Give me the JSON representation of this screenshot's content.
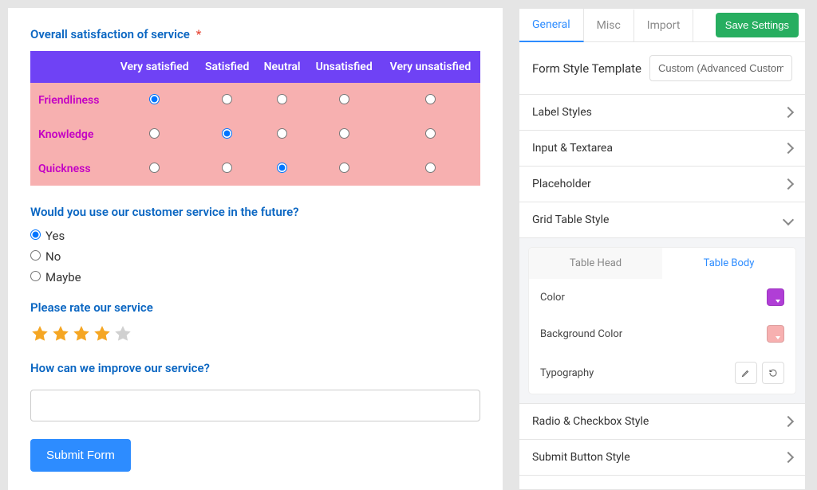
{
  "form": {
    "q1": {
      "label": "Overall satisfaction of service",
      "required": true,
      "columns": [
        "Very satisfied",
        "Satisfied",
        "Neutral",
        "Unsatisfied",
        "Very unsatisfied"
      ],
      "rows": [
        {
          "label": "Friendliness",
          "selected": 0
        },
        {
          "label": "Knowledge",
          "selected": 1
        },
        {
          "label": "Quickness",
          "selected": 2
        }
      ]
    },
    "q2": {
      "label": "Would you use our customer service in the future?",
      "options": [
        "Yes",
        "No",
        "Maybe"
      ],
      "selected": 0
    },
    "q3": {
      "label": "Please rate our service",
      "rating": 4,
      "max": 5
    },
    "q4": {
      "label": "How can we improve our service?",
      "value": ""
    },
    "submit_label": "Submit Form"
  },
  "settings": {
    "tabs": {
      "general": "General",
      "misc": "Misc",
      "import": "Import"
    },
    "active_tab": "general",
    "save_label": "Save Settings",
    "template": {
      "label": "Form Style Template",
      "value": "Custom (Advanced Customiz"
    },
    "accordion": [
      {
        "key": "label_styles",
        "label": "Label Styles",
        "open": false
      },
      {
        "key": "input_textarea",
        "label": "Input & Textarea",
        "open": false
      },
      {
        "key": "placeholder",
        "label": "Placeholder",
        "open": false
      },
      {
        "key": "grid_table",
        "label": "Grid Table Style",
        "open": true
      },
      {
        "key": "radio_checkbox",
        "label": "Radio & Checkbox Style",
        "open": false
      },
      {
        "key": "submit_button",
        "label": "Submit Button Style",
        "open": false
      }
    ],
    "grid_table": {
      "sub_tabs": {
        "head": "Table Head",
        "body": "Table Body"
      },
      "active_sub_tab": "body",
      "props": {
        "color": {
          "label": "Color",
          "value": "#b03ed6"
        },
        "background": {
          "label": "Background Color",
          "value": "#f7b0b0"
        },
        "typography": {
          "label": "Typography"
        }
      }
    }
  }
}
